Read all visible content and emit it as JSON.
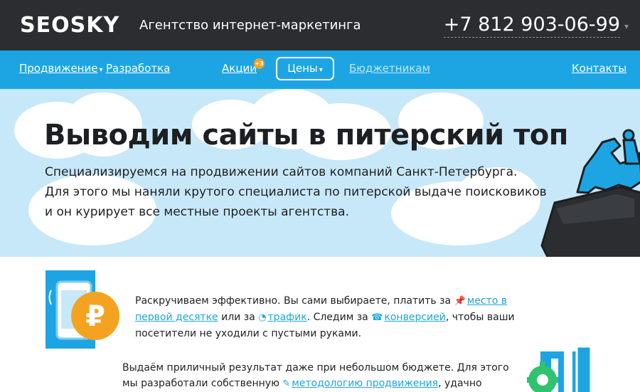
{
  "header": {
    "logo": "SEOSKY",
    "tagline": "Агентство интернет-маркетинга",
    "phone": "+7 812 903-06-99"
  },
  "nav": {
    "promotion": "Продвижение",
    "development": "Разработка",
    "promotions": "Акции",
    "promotions_badge": "+3",
    "prices": "Цены",
    "budget": "Бюджетникам",
    "contacts": "Контакты"
  },
  "hero": {
    "title": "Выводим сайты в питерский топ",
    "line1": "Специализируемся на продвижении сайтов компаний Санкт-Петербурга.",
    "line2": "Для этого мы наняли крутого специалиста по питерской выдаче поисковиков",
    "line3": "и он курирует все местные проекты агентства."
  },
  "feature1": {
    "t1": "Раскручиваем эффективно. Вы сами выбираете, платить за ",
    "link1": "место в первой десятке",
    "t2": " или за ",
    "link2": "трафик",
    "t3": ". Следим за ",
    "link3": "конверсией",
    "t4": ", чтобы ваши посетители не уходили с пустыми руками."
  },
  "feature2": {
    "t1": "Выдаём приличный результат даже при небольшом бюджете. Для этого мы разработали собственную ",
    "link1": "методологию продвижения",
    "t2": ", удачно показавшую"
  },
  "colors": {
    "topbar": "#2b2d30",
    "nav": "#1da5e3",
    "hero": "#c7e8f8",
    "accent_orange": "#f4a321",
    "link": "#1da5e3",
    "gear_green": "#2ec36e"
  },
  "icons": {
    "pin": "pushpin-icon",
    "traffic": "speedometer-icon",
    "conversion": "phone-icon",
    "method": "magic-wand-icon"
  }
}
